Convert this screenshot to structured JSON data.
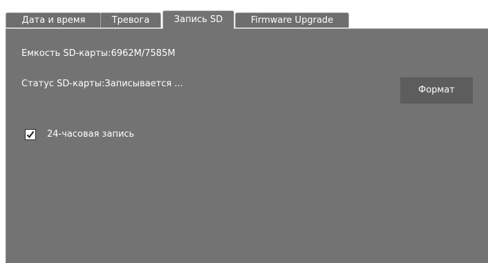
{
  "tabs": [
    {
      "label": "Дата и время",
      "active": false
    },
    {
      "label": "Тревога",
      "active": false
    },
    {
      "label": "Запись SD",
      "active": true
    },
    {
      "label": "Firmware Upgrade",
      "active": false
    }
  ],
  "sd": {
    "capacity_text": "Емкость SD-карты:6962M/7585M",
    "status_text": "Статус SD-карты:Записывается ..."
  },
  "format_button": {
    "label": "Формат"
  },
  "record_24h": {
    "label": "24-часовая запись",
    "checked": true,
    "icon": "checkmark-icon"
  },
  "colors": {
    "panel": "#737373",
    "button": "#5d5d5d",
    "text": "#ffffff"
  }
}
